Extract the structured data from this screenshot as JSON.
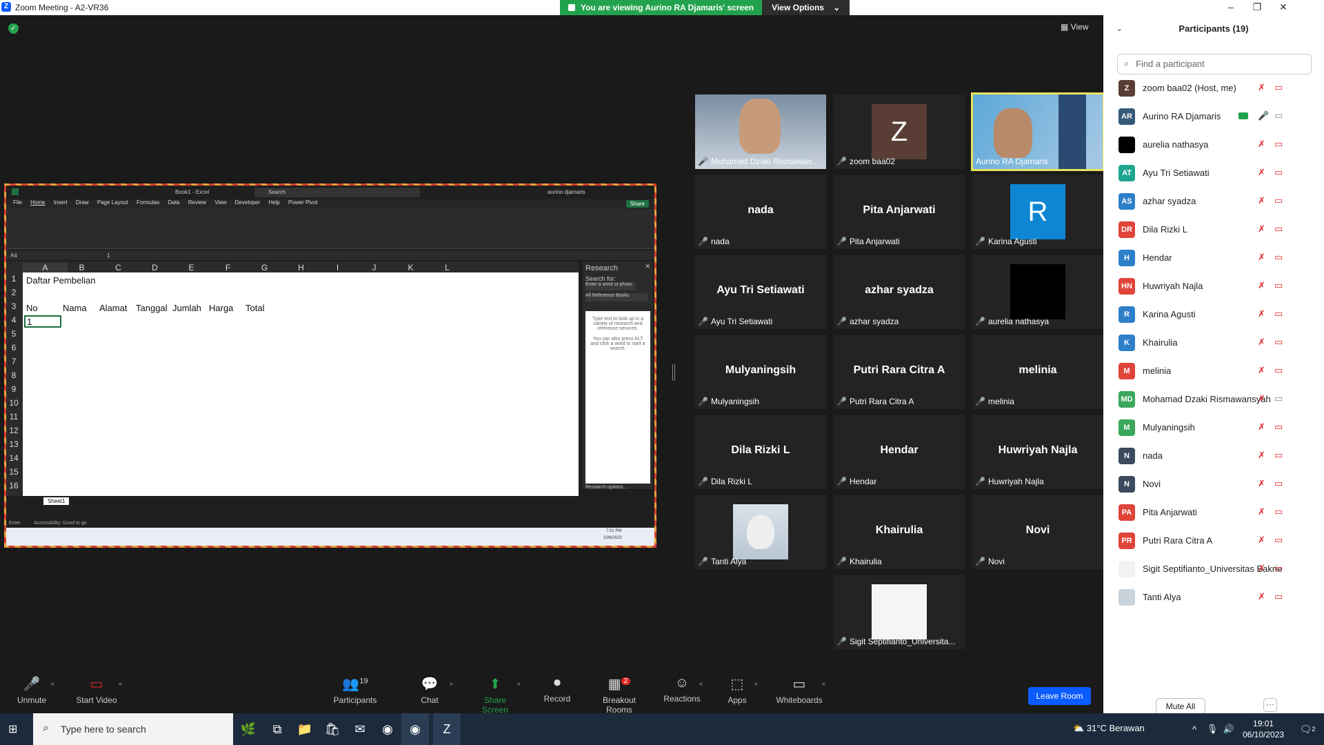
{
  "window": {
    "title": "Zoom Meeting - A2-VR36",
    "minimize": "–",
    "maximize": "❐",
    "close": "✕"
  },
  "share_banner": {
    "text": "You are viewing Aurino RA Djamaris' screen",
    "view_options": "View Options",
    "chevron": "⌄"
  },
  "meeting": {
    "view_label": "View",
    "shield_glyph": "✓"
  },
  "excel": {
    "title": "Book1 - Excel",
    "search": "Search",
    "user": "aurino djamaris",
    "share_label": "Share",
    "tabs": [
      "File",
      "Home",
      "Insert",
      "Draw",
      "Page Layout",
      "Formulas",
      "Data",
      "Review",
      "View",
      "Developer",
      "Help",
      "Power Pivot"
    ],
    "name_box": "A4",
    "formula": "1",
    "columns": [
      "A",
      "B",
      "C",
      "D",
      "E",
      "F",
      "G",
      "H",
      "I",
      "J",
      "K",
      "L"
    ],
    "rows": [
      "1",
      "2",
      "3",
      "4",
      "5",
      "6",
      "7",
      "8",
      "9",
      "10",
      "11",
      "12",
      "13",
      "14",
      "15",
      "16"
    ],
    "cells": {
      "a1": "Daftar Pembelian",
      "a3": "No",
      "b3": "Nama",
      "c3": "Alamat",
      "d3": "Tanggal",
      "e3": "Jumlah",
      "f3": "Harga",
      "g3": "Total",
      "a4": "1"
    },
    "research": {
      "title": "Research",
      "search_for": "Search for:",
      "placeholder": "Enter a word or phras",
      "source": "All Reference Books",
      "pane_text": "Type text to look up in a variety of research and reference services.",
      "pane_text2": "You can also press ALT and click a word to start a search.",
      "options": "Research options..."
    },
    "sheet_tab": "Sheet1",
    "status": "Enter",
    "accessibility": "Accessibility: Good to go",
    "clock_time": "7:01 PM",
    "clock_date": "10/6/2023"
  },
  "tiles": [
    {
      "label": "Mohamad Dzaki Rismawan...",
      "big": "",
      "avatar": "",
      "avatar_color": "",
      "type": "video-person"
    },
    {
      "label": "zoom baa02",
      "big": "",
      "avatar": "Z",
      "avatar_color": "#5a3e36",
      "type": "avatar"
    },
    {
      "label": "Aurino RA Djamaris",
      "big": "",
      "avatar": "",
      "avatar_color": "",
      "type": "video-building"
    },
    {
      "label": "nada",
      "big": "nada",
      "avatar": "",
      "avatar_color": "",
      "type": "name"
    },
    {
      "label": "Pita Anjarwati",
      "big": "Pita Anjarwati",
      "avatar": "",
      "avatar_color": "",
      "type": "name"
    },
    {
      "label": "Karina Agusti",
      "big": "",
      "avatar": "R",
      "avatar_color": "#0e86d4",
      "type": "avatar"
    },
    {
      "label": "Ayu Tri Setiawati",
      "big": "Ayu Tri Setiawati",
      "avatar": "",
      "avatar_color": "",
      "type": "name"
    },
    {
      "label": "azhar syadza",
      "big": "azhar syadza",
      "avatar": "",
      "avatar_color": "",
      "type": "name"
    },
    {
      "label": "aurelia nathasya",
      "big": "",
      "avatar": "",
      "avatar_color": "#000000",
      "type": "avatar"
    },
    {
      "label": "Mulyaningsih",
      "big": "Mulyaningsih",
      "avatar": "",
      "avatar_color": "",
      "type": "name"
    },
    {
      "label": "Putri Rara Citra A",
      "big": "Putri Rara Citra A",
      "avatar": "",
      "avatar_color": "",
      "type": "name"
    },
    {
      "label": "melinia",
      "big": "melinia",
      "avatar": "",
      "avatar_color": "",
      "type": "name"
    },
    {
      "label": "Dila Rizki L",
      "big": "Dila Rizki L",
      "avatar": "",
      "avatar_color": "",
      "type": "name"
    },
    {
      "label": "Hendar",
      "big": "Hendar",
      "avatar": "",
      "avatar_color": "",
      "type": "name"
    },
    {
      "label": "Huwriyah Najla",
      "big": "Huwriyah Najla",
      "avatar": "",
      "avatar_color": "",
      "type": "name"
    },
    {
      "label": "Tanti Alya",
      "big": "",
      "avatar": "",
      "avatar_color": "#c9d3dc",
      "type": "photo"
    },
    {
      "label": "Khairulia",
      "big": "Khairulia",
      "avatar": "",
      "avatar_color": "",
      "type": "name"
    },
    {
      "label": "Novi",
      "big": "Novi",
      "avatar": "",
      "avatar_color": "",
      "type": "name"
    },
    {
      "label": "Sigit Septifianto_Universita...",
      "big": "",
      "avatar": "",
      "avatar_color": "#f5f5f5",
      "type": "avatar"
    }
  ],
  "toolbar": {
    "unmute": "Unmute",
    "start_video": "Start Video",
    "participants": "Participants",
    "participants_count": "19",
    "chat": "Chat",
    "share_screen": "Share Screen",
    "record": "Record",
    "breakout": "Breakout Rooms",
    "breakout_badge": "2",
    "reactions": "Reactions",
    "apps": "Apps",
    "whiteboards": "Whiteboards",
    "leave": "Leave Room",
    "caret": "^"
  },
  "panel": {
    "title": "Participants (19)",
    "collapse": "⌄",
    "search_placeholder": "Find a participant",
    "mute_all": "Mute All",
    "more": "···",
    "participants": [
      {
        "initials": "Z",
        "name": "zoom baa02 (Host, me)",
        "color": "#5a3e36",
        "mic": "muted",
        "cam": "off"
      },
      {
        "initials": "AR",
        "name": "Aurino RA Djamaris",
        "color": "#36597a",
        "mic": "on",
        "cam": "on",
        "sharing": true
      },
      {
        "initials": "",
        "name": "aurelia nathasya",
        "color": "#000000",
        "mic": "muted",
        "cam": "off"
      },
      {
        "initials": "AT",
        "name": "Ayu Tri Setiawati",
        "color": "#1fa58f",
        "mic": "muted",
        "cam": "off"
      },
      {
        "initials": "AS",
        "name": "azhar syadza",
        "color": "#2e7fc9",
        "mic": "muted",
        "cam": "off"
      },
      {
        "initials": "DR",
        "name": "Dila Rizki L",
        "color": "#e0443a",
        "mic": "muted",
        "cam": "off"
      },
      {
        "initials": "H",
        "name": "Hendar",
        "color": "#2e7fc9",
        "mic": "muted",
        "cam": "off"
      },
      {
        "initials": "HN",
        "name": "Huwriyah Najla",
        "color": "#e0443a",
        "mic": "muted",
        "cam": "off"
      },
      {
        "initials": "R",
        "name": "Karina Agusti",
        "color": "#2e7fc9",
        "mic": "muted",
        "cam": "off"
      },
      {
        "initials": "K",
        "name": "Khairulia",
        "color": "#2e7fc9",
        "mic": "muted",
        "cam": "off"
      },
      {
        "initials": "M",
        "name": "melinia",
        "color": "#e0443a",
        "mic": "muted",
        "cam": "off"
      },
      {
        "initials": "MD",
        "name": "Mohamad Dzaki Rismawansyah",
        "color": "#3aa75c",
        "mic": "muted",
        "cam": "on"
      },
      {
        "initials": "M",
        "name": "Mulyaningsih",
        "color": "#3aa75c",
        "mic": "muted",
        "cam": "off"
      },
      {
        "initials": "N",
        "name": "nada",
        "color": "#3b4a5c",
        "mic": "muted",
        "cam": "off"
      },
      {
        "initials": "N",
        "name": "Novi",
        "color": "#3b4a5c",
        "mic": "muted",
        "cam": "off"
      },
      {
        "initials": "PA",
        "name": "Pita Anjarwati",
        "color": "#e0443a",
        "mic": "muted",
        "cam": "off"
      },
      {
        "initials": "PR",
        "name": "Putri Rara Citra A",
        "color": "#e0443a",
        "mic": "muted",
        "cam": "off"
      },
      {
        "initials": "",
        "name": "Sigit Septifianto_Universitas Bakrie",
        "color": "#f2f2f2",
        "mic": "muted",
        "cam": "off"
      },
      {
        "initials": "",
        "name": "Tanti Alya",
        "color": "#c9d3dc",
        "mic": "muted",
        "cam": "off"
      }
    ]
  },
  "taskbar": {
    "search_placeholder": "Type here to search",
    "weather": "31°C  Berawan",
    "time": "19:01",
    "date": "06/10/2023",
    "notif_count": "2"
  }
}
